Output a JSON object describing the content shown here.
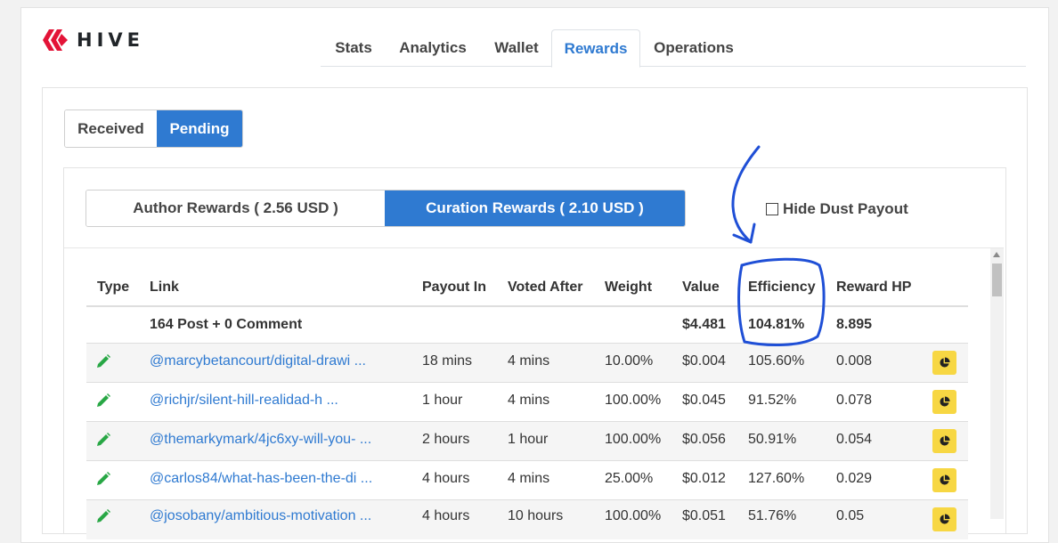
{
  "brand": {
    "name": "HIVE",
    "accent": "#e31337"
  },
  "nav": {
    "tabs": [
      {
        "label": "Stats"
      },
      {
        "label": "Analytics"
      },
      {
        "label": "Wallet"
      },
      {
        "label": "Rewards",
        "active": true
      },
      {
        "label": "Operations"
      }
    ]
  },
  "status_toggle": {
    "received": "Received",
    "pending": "Pending",
    "selected": "Pending"
  },
  "reward_toggle": {
    "author": "Author Rewards ( 2.56 USD )",
    "curation": "Curation Rewards ( 2.10 USD )",
    "selected": "curation"
  },
  "hide_dust": {
    "label": "Hide Dust Payout",
    "checked": false
  },
  "table": {
    "headers": {
      "type": "Type",
      "link": "Link",
      "payout_in": "Payout In",
      "voted_after": "Voted After",
      "weight": "Weight",
      "value": "Value",
      "efficiency": "Efficiency",
      "reward_hp": "Reward HP"
    },
    "summary": {
      "count": "164 Post + 0 Comment",
      "value": "$4.481",
      "efficiency": "104.81%",
      "reward_hp": "8.895"
    },
    "rows": [
      {
        "link": "@marcybetancourt/digital-drawi ...",
        "payout_in": "18 mins",
        "voted_after": "4 mins",
        "weight": "10.00%",
        "value": "$0.004",
        "efficiency": "105.60%",
        "reward_hp": "0.008"
      },
      {
        "link": "@richjr/silent-hill-realidad-h ...",
        "payout_in": "1 hour",
        "voted_after": "4 mins",
        "weight": "100.00%",
        "value": "$0.045",
        "efficiency": "91.52%",
        "reward_hp": "0.078"
      },
      {
        "link": "@themarkymark/4jc6xy-will-you- ...",
        "payout_in": "2 hours",
        "voted_after": "1 hour",
        "weight": "100.00%",
        "value": "$0.056",
        "efficiency": "50.91%",
        "reward_hp": "0.054"
      },
      {
        "link": "@carlos84/what-has-been-the-di ...",
        "payout_in": "4 hours",
        "voted_after": "4 mins",
        "weight": "25.00%",
        "value": "$0.012",
        "efficiency": "127.60%",
        "reward_hp": "0.029"
      },
      {
        "link": "@josobany/ambitious-motivation ...",
        "payout_in": "4 hours",
        "voted_after": "10 hours",
        "weight": "100.00%",
        "value": "$0.051",
        "efficiency": "51.76%",
        "reward_hp": "0.05"
      }
    ]
  },
  "icons": {
    "type_icon": "pencil-icon",
    "action_icon": "pie-chart-icon"
  },
  "colors": {
    "primary": "#2f7ad1",
    "pencil": "#28a745",
    "action": "#f7d743",
    "annotation": "#1f4fd6"
  }
}
